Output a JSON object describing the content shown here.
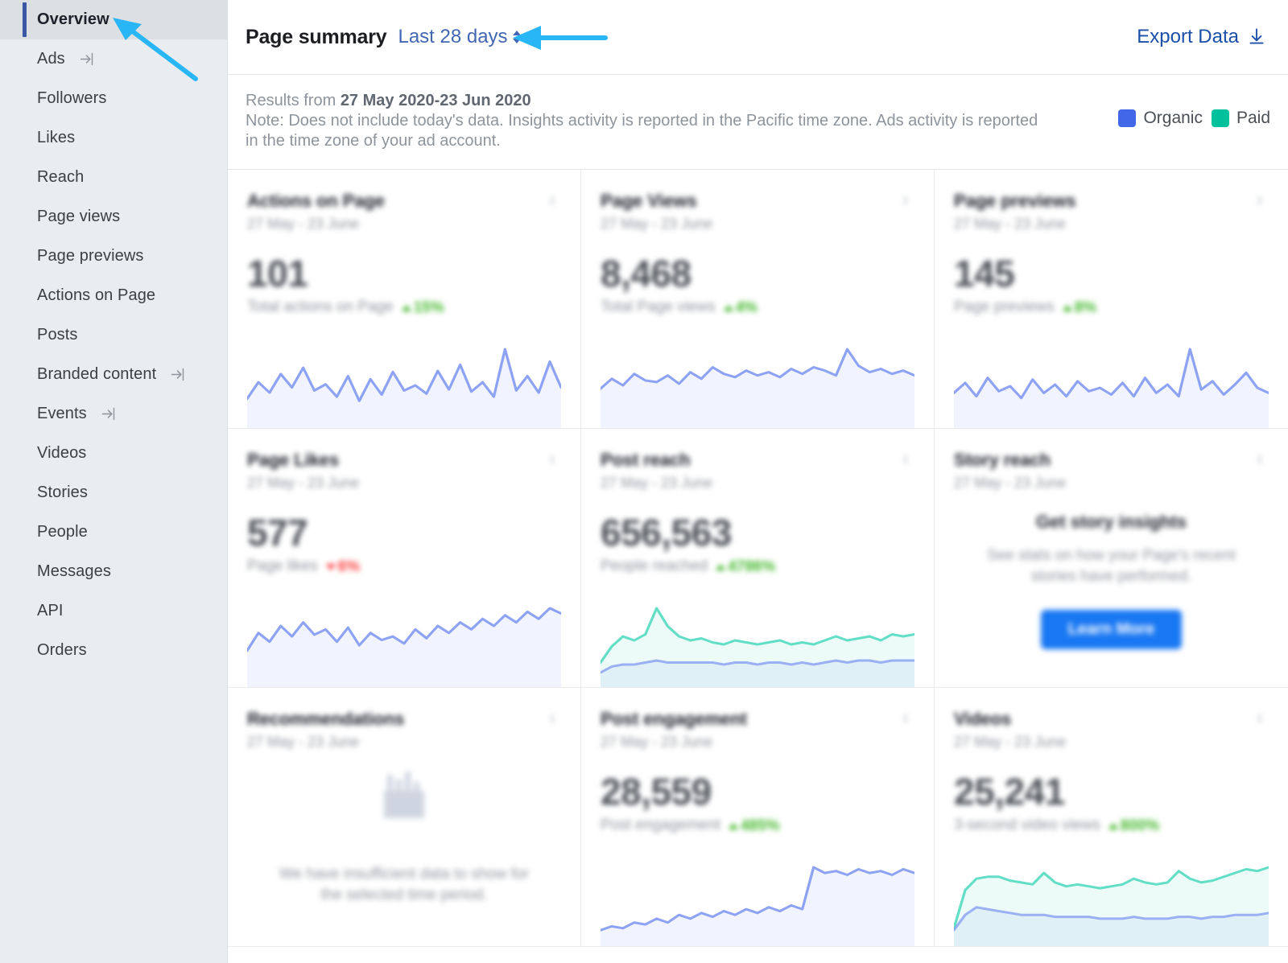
{
  "sidebar": {
    "items": [
      {
        "label": "Overview",
        "active": true,
        "external": false
      },
      {
        "label": "Ads",
        "active": false,
        "external": true
      },
      {
        "label": "Followers",
        "active": false,
        "external": false
      },
      {
        "label": "Likes",
        "active": false,
        "external": false
      },
      {
        "label": "Reach",
        "active": false,
        "external": false
      },
      {
        "label": "Page views",
        "active": false,
        "external": false
      },
      {
        "label": "Page previews",
        "active": false,
        "external": false
      },
      {
        "label": "Actions on Page",
        "active": false,
        "external": false
      },
      {
        "label": "Posts",
        "active": false,
        "external": false
      },
      {
        "label": "Branded content",
        "active": false,
        "external": true
      },
      {
        "label": "Events",
        "active": false,
        "external": true
      },
      {
        "label": "Videos",
        "active": false,
        "external": false
      },
      {
        "label": "Stories",
        "active": false,
        "external": false
      },
      {
        "label": "People",
        "active": false,
        "external": false
      },
      {
        "label": "Messages",
        "active": false,
        "external": false
      },
      {
        "label": "API",
        "active": false,
        "external": false
      },
      {
        "label": "Orders",
        "active": false,
        "external": false
      }
    ]
  },
  "header": {
    "title": "Page summary",
    "date_range": "Last 28 days",
    "export_label": "Export Data"
  },
  "notes": {
    "results_prefix": "Results from ",
    "results_range": "27 May 2020-23 Jun 2020",
    "note_line1": "Note: Does not include today's data. Insights activity is reported in the Pacific time zone. Ads activity is reported",
    "note_line2": "in the time zone of your ad account."
  },
  "legend": {
    "items": [
      {
        "label": "Organic",
        "color": "#4267E8"
      },
      {
        "label": "Paid",
        "color": "#00C19B"
      }
    ]
  },
  "colors": {
    "organic": "#4267E8",
    "paid": "#00C19B",
    "sidebar_bg": "#E9EDF0",
    "active_bg": "#DCE0E3",
    "active_bar": "#3A56A5",
    "link": "#4267B2",
    "export_link": "#1B4FA8",
    "positive": "#42B72A",
    "negative": "#FA3E3E",
    "promo_button": "#1877F2",
    "annotation_arrow": "#29B6F6"
  },
  "cards": [
    {
      "title": "Actions on Page",
      "subtitle": "27 May - 23 June",
      "kind": "metric",
      "value": "101",
      "metric_label": "Total actions on Page",
      "delta": "15%",
      "delta_dir": "up",
      "series_color": "organic"
    },
    {
      "title": "Page Views",
      "subtitle": "27 May - 23 June",
      "kind": "metric",
      "value": "8,468",
      "metric_label": "Total Page views",
      "delta": "4%",
      "delta_dir": "up",
      "series_color": "organic"
    },
    {
      "title": "Page previews",
      "subtitle": "27 May - 23 June",
      "kind": "metric",
      "value": "145",
      "metric_label": "Page previews",
      "delta": "8%",
      "delta_dir": "up",
      "series_color": "organic"
    },
    {
      "title": "Page Likes",
      "subtitle": "27 May - 23 June",
      "kind": "metric",
      "value": "577",
      "metric_label": "Page likes",
      "delta": "6%",
      "delta_dir": "down",
      "series_color": "organic"
    },
    {
      "title": "Post reach",
      "subtitle": "27 May - 23 June",
      "kind": "metric",
      "value": "656,563",
      "metric_label": "People reached",
      "delta": "4786%",
      "delta_dir": "up",
      "series_color": "paid"
    },
    {
      "title": "Story reach",
      "subtitle": "27 May - 23 June",
      "kind": "promo",
      "promo_title": "Get story insights",
      "promo_body": "See stats on how your Page's recent stories have performed.",
      "promo_button": "Learn More"
    },
    {
      "title": "Recommendations",
      "subtitle": "27 May - 23 June",
      "kind": "empty",
      "empty_text": "We have insufficient data to show for the selected time period."
    },
    {
      "title": "Post engagement",
      "subtitle": "27 May - 23 June",
      "kind": "metric",
      "value": "28,559",
      "metric_label": "Post engagement",
      "delta": "485%",
      "delta_dir": "up",
      "series_color": "organic"
    },
    {
      "title": "Videos",
      "subtitle": "27 May - 23 June",
      "kind": "metric",
      "value": "25,241",
      "metric_label": "3-second video views",
      "delta": "800%",
      "delta_dir": "up",
      "series_color": "paid"
    }
  ],
  "chart_data": {
    "type": "line",
    "title": "Page summary sparklines",
    "legend": [
      "Organic",
      "Paid"
    ],
    "grid": false,
    "xlabel": "",
    "ylabel": "",
    "sparklines": [
      {
        "card": "Actions on Page",
        "series": [
          {
            "name": "Organic",
            "values": [
              22,
              38,
              28,
              46,
              33,
              52,
              30,
              36,
              24,
              44,
              20,
              41,
              26,
              48,
              30,
              35,
              27,
              49,
              31,
              55,
              29,
              38,
              24,
              70,
              30,
              44,
              28,
              58,
              33
            ]
          }
        ]
      },
      {
        "card": "Page Views",
        "series": [
          {
            "name": "Organic",
            "values": [
              40,
              52,
              44,
              58,
              50,
              48,
              56,
              46,
              60,
              52,
              66,
              58,
              54,
              62,
              56,
              60,
              54,
              64,
              58,
              66,
              62,
              56,
              88,
              68,
              60,
              64,
              58,
              62,
              56
            ]
          }
        ]
      },
      {
        "card": "Page previews",
        "series": [
          {
            "name": "Organic",
            "values": [
              34,
              46,
              30,
              52,
              36,
              42,
              28,
              50,
              34,
              44,
              30,
              48,
              36,
              40,
              32,
              46,
              30,
              52,
              34,
              44,
              30,
              86,
              38,
              48,
              32,
              44,
              58,
              40,
              34
            ]
          }
        ]
      },
      {
        "card": "Page Likes",
        "series": [
          {
            "name": "Organic",
            "values": [
              34,
              54,
              44,
              62,
              50,
              66,
              52,
              58,
              44,
              60,
              40,
              54,
              46,
              50,
              42,
              58,
              48,
              62,
              54,
              66,
              58,
              70,
              62,
              74,
              66,
              78,
              70,
              82,
              76
            ]
          }
        ]
      },
      {
        "card": "Post reach",
        "series": [
          {
            "name": "Paid",
            "values": [
              18,
              34,
              44,
              40,
              46,
              72,
              54,
              44,
              40,
              42,
              38,
              36,
              40,
              38,
              36,
              38,
              40,
              36,
              38,
              36,
              40,
              44,
              40,
              42,
              44,
              40,
              46,
              44,
              46
            ]
          },
          {
            "name": "Organic",
            "values": [
              8,
              14,
              16,
              16,
              18,
              20,
              18,
              18,
              18,
              18,
              18,
              16,
              18,
              18,
              16,
              18,
              18,
              16,
              18,
              16,
              18,
              20,
              18,
              20,
              20,
              18,
              20,
              20,
              20
            ]
          }
        ]
      },
      {
        "card": "Post engagement",
        "series": [
          {
            "name": "Organic",
            "values": [
              10,
              14,
              12,
              18,
              16,
              22,
              18,
              26,
              22,
              28,
              24,
              30,
              26,
              32,
              28,
              34,
              30,
              36,
              32,
              76,
              70,
              72,
              68,
              74,
              70,
              72,
              68,
              74,
              70
            ]
          }
        ]
      },
      {
        "card": "Videos",
        "series": [
          {
            "name": "Paid",
            "values": [
              12,
              52,
              64,
              66,
              66,
              62,
              60,
              58,
              70,
              60,
              56,
              58,
              56,
              54,
              56,
              58,
              64,
              60,
              58,
              60,
              72,
              64,
              60,
              62,
              66,
              70,
              74,
              72,
              76
            ]
          },
          {
            "name": "Organic",
            "values": [
              10,
              26,
              34,
              32,
              30,
              28,
              26,
              26,
              26,
              24,
              24,
              24,
              24,
              22,
              22,
              22,
              24,
              22,
              22,
              22,
              24,
              24,
              22,
              24,
              24,
              26,
              26,
              26,
              28
            ]
          }
        ]
      }
    ]
  }
}
